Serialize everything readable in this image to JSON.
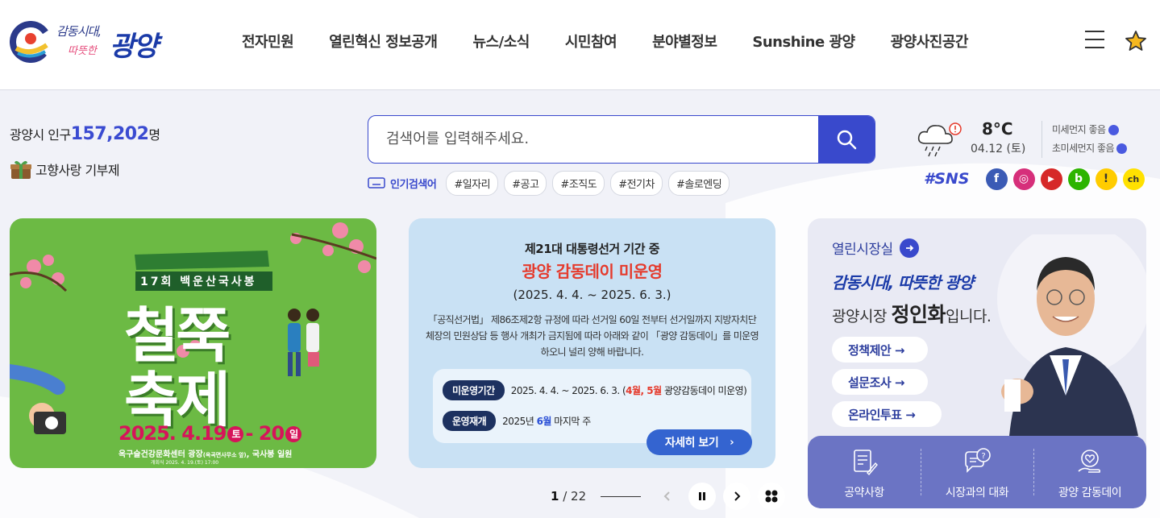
{
  "header": {
    "logo": {
      "line1": "감동시대,",
      "line2": "따뜻한",
      "name": "광양"
    },
    "nav": [
      "전자민원",
      "열린혁신 정보공개",
      "뉴스/소식",
      "시민참여",
      "분야별정보",
      "Sunshine 광양",
      "광양사진공간"
    ],
    "menu_icon": "hamburger-icon",
    "favorite_icon": "star-icon"
  },
  "population": {
    "label": "광양시 인구",
    "value": "157,202",
    "unit": "명"
  },
  "hometown": {
    "label": "고향사랑 기부제",
    "icon": "gift-box-icon"
  },
  "search": {
    "placeholder": "검색어를 입력해주세요.",
    "icon": "search-icon",
    "popular_label": "인기검색어",
    "tags": [
      "#일자리",
      "#공고",
      "#조직도",
      "#전기차",
      "#솔로엔딩"
    ]
  },
  "weather": {
    "icon": "rain-cloud-icon",
    "temp": "8°C",
    "date": "04.12 (토)",
    "fine_dust": "미세먼지 좋음",
    "ultra_fine_dust": "초미세먼지 좋음"
  },
  "sns": {
    "label": "#SNS",
    "items": [
      {
        "name": "facebook",
        "color": "#3b5bb5",
        "glyph": "f"
      },
      {
        "name": "instagram",
        "color": "#d62f7a",
        "glyph": "◎"
      },
      {
        "name": "youtube",
        "color": "#d62828",
        "glyph": "▶"
      },
      {
        "name": "blog",
        "color": "#2db400",
        "glyph": "b"
      },
      {
        "name": "kakaostory",
        "color": "#ffcc00",
        "glyph": "!"
      },
      {
        "name": "kakaochannel",
        "color": "#ffe100",
        "glyph": "ch"
      }
    ]
  },
  "festival": {
    "badge": "17회 백운산국사봉",
    "title1": "철쭉",
    "title2": "축제",
    "date": "2025. 4.19",
    "day1": "토",
    "date2": "- 20",
    "day2": "일",
    "place": "옥구슬건강문화센터 광장",
    "place_sub": "(옥곡면사무소 앞)",
    "place2": ", 국사봉 일원",
    "opening": "개회식  2025. 4. 19.(토) 17:00"
  },
  "notice": {
    "title1": "제21대 대통령선거 기간 중",
    "title2": "광양 감동데이 미운영",
    "period": "(2025. 4. 4. ~ 2025. 6. 3.)",
    "body": "「공직선거법」 제86조제2항 규정에 따라 선거일 60일 전부터 선거일까지 지방자치단체장의 민원상담 등 행사 개최가 금지됨에 따라 아래와 같이 「광양 감동데이」를 미운영하오니 널리 양해 바랍니다.",
    "row1_label": "미운영기간",
    "row1_text_a": "2025. 4. 4. ~ 2025. 6. 3. (",
    "row1_text_b": "4월, 5월",
    "row1_text_c": " 광양감동데이 미운영)",
    "row2_label": "운영재개",
    "row2_text_a": "2025년 ",
    "row2_text_b": "6월",
    "row2_text_c": " 마지막 주",
    "detail_btn": "자세히 보기"
  },
  "pager": {
    "current": "1",
    "separator": " / ",
    "total": "22"
  },
  "mayor": {
    "link": "열린시장실",
    "slogan": "감동시대, 따뜻한 광양",
    "name_prefix": "광양시장 ",
    "name": "정인화",
    "name_suffix": "입니다.",
    "buttons": [
      "정책제안 →",
      "설문조사 →",
      "온라인투표 →"
    ],
    "menu": [
      {
        "label": "공약사항",
        "icon": "document-pen-icon"
      },
      {
        "label": "시장과의 대화",
        "icon": "chat-question-icon"
      },
      {
        "label": "광양 감동데이",
        "icon": "heart-hand-icon"
      }
    ]
  }
}
